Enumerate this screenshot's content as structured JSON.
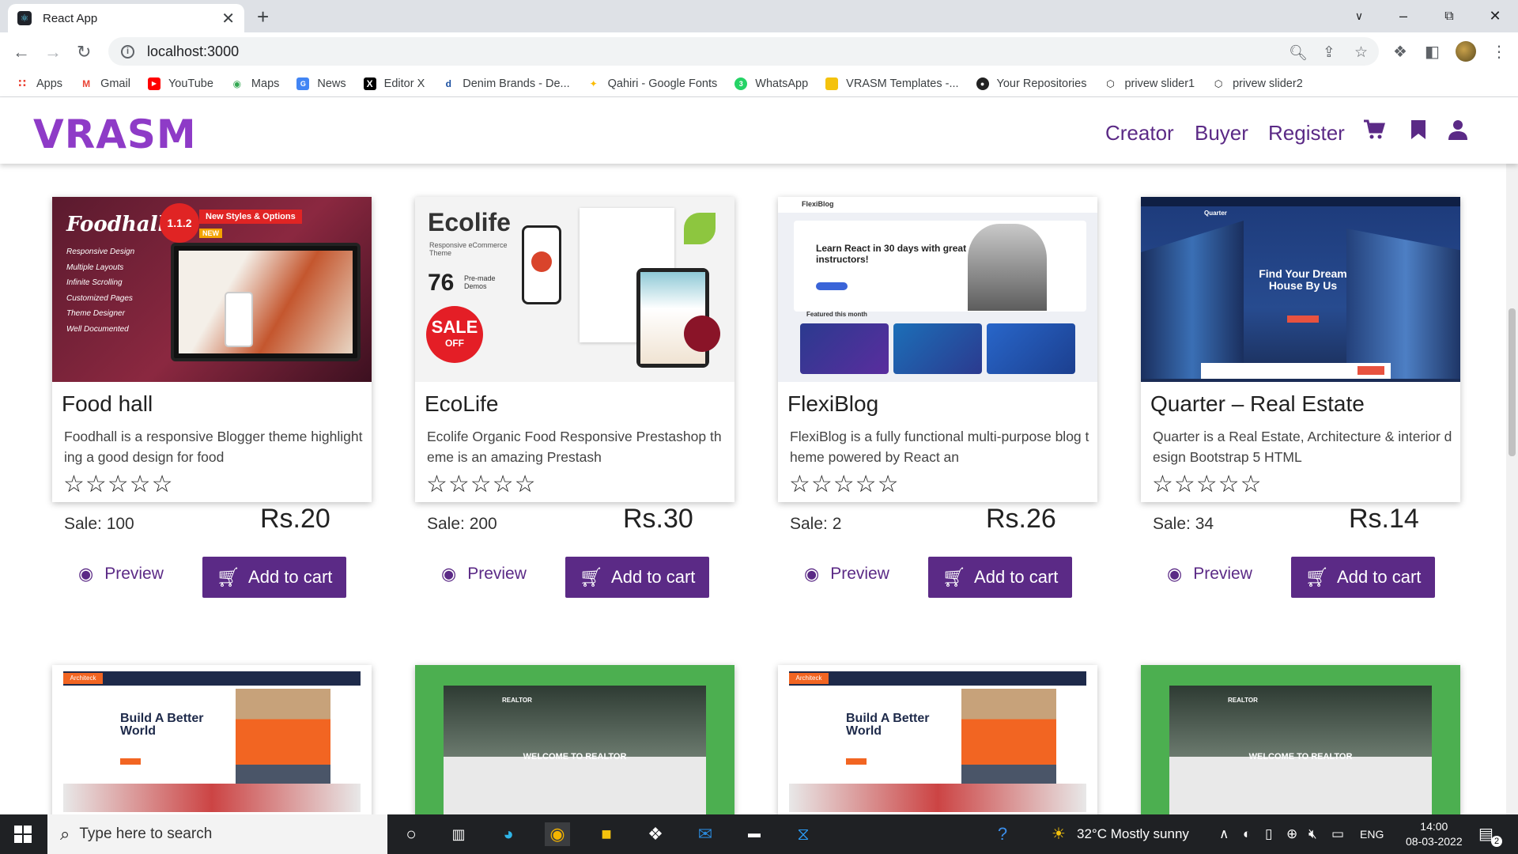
{
  "browser": {
    "tab_title": "React App",
    "url": "localhost:3000",
    "bookmarks": [
      {
        "label": "Apps",
        "icon": "apps-grid-icon"
      },
      {
        "label": "Gmail",
        "icon": "gmail-icon"
      },
      {
        "label": "YouTube",
        "icon": "youtube-icon"
      },
      {
        "label": "Maps",
        "icon": "maps-icon"
      },
      {
        "label": "News",
        "icon": "news-icon"
      },
      {
        "label": "Editor X",
        "icon": "editorx-icon"
      },
      {
        "label": "Denim Brands - De...",
        "icon": "denim-icon"
      },
      {
        "label": "Qahiri - Google Fonts",
        "icon": "google-fonts-icon"
      },
      {
        "label": "WhatsApp",
        "icon": "whatsapp-icon"
      },
      {
        "label": "VRASM Templates -...",
        "icon": "folder-icon"
      },
      {
        "label": "Your Repositories",
        "icon": "github-icon"
      },
      {
        "label": "privew slider1",
        "icon": "codepen-icon"
      },
      {
        "label": "privew slider2",
        "icon": "codepen-icon"
      }
    ]
  },
  "navbar": {
    "logo": "VRASM",
    "links": [
      "Creator",
      "Buyer",
      "Register"
    ]
  },
  "cards": [
    {
      "title": "Food hall",
      "desc": "Foodhall is a responsive Blogger theme highlighting a good design for food",
      "sale": "Sale: 100",
      "price": "Rs.20",
      "thumb_heading": "Foodhall",
      "thumb_version": "1.1.2",
      "thumb_badge": "New Styles & Options",
      "thumb_new": "NEW",
      "thumb_features": [
        "Responsive Design",
        "Multiple Layouts",
        "Infinite Scrolling",
        "Customized Pages",
        "Theme Designer",
        "Well Documented"
      ]
    },
    {
      "title": "EcoLife",
      "desc": "Ecolife Organic Food Responsive Prestashop theme is an amazing Prestash",
      "sale": "Sale: 200",
      "price": "Rs.30",
      "thumb_heading": "Ecolife",
      "thumb_sub": "Responsive eCommerce Theme",
      "thumb_count": "76",
      "thumb_demos": "Pre-made Demos",
      "thumb_sale": "SALE",
      "thumb_off": "OFF"
    },
    {
      "title": "FlexiBlog",
      "desc": "FlexiBlog is a fully functional multi-purpose blog theme powered by React an",
      "sale": "Sale: 2",
      "price": "Rs.26",
      "thumb_brand": "FlexiBlog",
      "thumb_heading": "Learn React in 30 days with great instructors!",
      "thumb_featured": "Featured this month"
    },
    {
      "title": "Quarter – Real Estate",
      "desc": "Quarter is a Real Estate, Architecture & interior design Bootstrap 5 HTML",
      "sale": "Sale: 34",
      "price": "Rs.14",
      "thumb_brand": "Quarter",
      "thumb_heading": "Find Your Dream House By Us"
    }
  ],
  "cards_row2": [
    {
      "thumb_brand": "Architeck",
      "thumb_heading": "Build A Better World",
      "bg": "#ffffff"
    },
    {
      "thumb_brand": "REALTOR",
      "thumb_heading": "WELCOME TO REALTOR",
      "bg": "#4caf50"
    },
    {
      "thumb_brand": "Architeck",
      "thumb_heading": "Build A Better World",
      "bg": "#ffffff"
    },
    {
      "thumb_brand": "REALTOR",
      "thumb_heading": "WELCOME TO REALTOR",
      "bg": "#4caf50"
    }
  ],
  "labels": {
    "preview": "Preview",
    "add_to_cart": "Add to cart",
    "stars": "☆☆☆☆☆"
  },
  "rating": {
    "value": 0,
    "max": 5
  },
  "taskbar": {
    "search_placeholder": "Type here to search",
    "weather": "32°C  Mostly sunny",
    "language": "ENG",
    "time": "14:00",
    "date": "08-03-2022",
    "notifications": "2"
  },
  "colors": {
    "brand": "#5b2a86",
    "logo": "#8e3bc7"
  }
}
